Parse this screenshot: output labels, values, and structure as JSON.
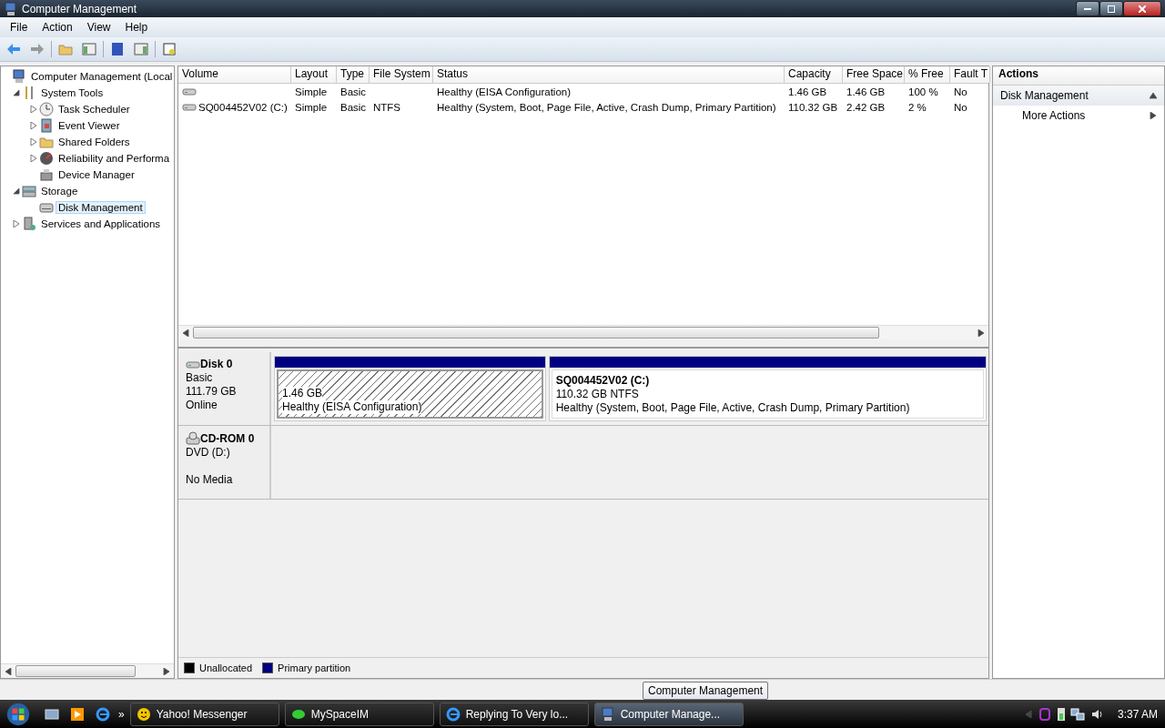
{
  "window": {
    "title": "Computer Management"
  },
  "menu": [
    "File",
    "Action",
    "View",
    "Help"
  ],
  "tree": [
    {
      "label": "Computer Management (Local",
      "children": [
        {
          "label": "System Tools",
          "expanded": true,
          "children": [
            {
              "label": "Task Scheduler",
              "expanded": false
            },
            {
              "label": "Event Viewer",
              "expanded": false
            },
            {
              "label": "Shared Folders",
              "expanded": false
            },
            {
              "label": "Reliability and Performa",
              "expanded": false
            },
            {
              "label": "Device Manager"
            }
          ]
        },
        {
          "label": "Storage",
          "expanded": true,
          "children": [
            {
              "label": "Disk Management",
              "selected": true
            }
          ]
        },
        {
          "label": "Services and Applications",
          "expanded": false
        }
      ]
    }
  ],
  "table": {
    "columns": [
      "Volume",
      "Layout",
      "Type",
      "File System",
      "Status",
      "Capacity",
      "Free Space",
      "% Free",
      "Fault T"
    ],
    "rows": [
      {
        "cells": [
          "",
          "Simple",
          "Basic",
          "",
          "Healthy (EISA Configuration)",
          "1.46 GB",
          "1.46 GB",
          "100 %",
          "No"
        ]
      },
      {
        "cells": [
          "SQ004452V02 (C:)",
          "Simple",
          "Basic",
          "NTFS",
          "Healthy (System, Boot, Page File, Active, Crash Dump, Primary Partition)",
          "110.32 GB",
          "2.42 GB",
          "2 %",
          "No"
        ]
      }
    ]
  },
  "disks": [
    {
      "kind": "disk",
      "name": "Disk 0",
      "lines": [
        "Basic",
        "111.79 GB",
        "Online"
      ],
      "partitions": [
        {
          "lines": [
            "1.46 GB",
            "Healthy (EISA Configuration)"
          ],
          "color": "#000080",
          "selected": true
        },
        {
          "title": "SQ004452V02  (C:)",
          "lines": [
            "110.32 GB NTFS",
            "Healthy (System, Boot, Page File, Active, Crash Dump, Primary Partition)"
          ],
          "color": "#000080",
          "selected": false
        }
      ]
    },
    {
      "kind": "cdrom",
      "name": "CD-ROM 0",
      "lines": [
        "DVD (D:)",
        "No Media"
      ]
    }
  ],
  "legend": [
    {
      "label": "Unallocated",
      "color": "#000000"
    },
    {
      "label": "Primary partition",
      "color": "#000080"
    }
  ],
  "actions": {
    "title": "Actions",
    "sections": [
      {
        "label": "Disk Management",
        "expanded": true,
        "items": [
          "More Actions"
        ]
      }
    ]
  },
  "tooltip": "Computer Management",
  "taskbar": {
    "tasks": [
      {
        "label": "Yahoo! Messenger",
        "selected": false
      },
      {
        "label": "MySpaceIM",
        "selected": false
      },
      {
        "label": "Replying To Very lo...",
        "selected": false
      },
      {
        "label": "Computer Manage...",
        "selected": true
      }
    ],
    "overflow": "»",
    "clock": "3:37 AM"
  }
}
